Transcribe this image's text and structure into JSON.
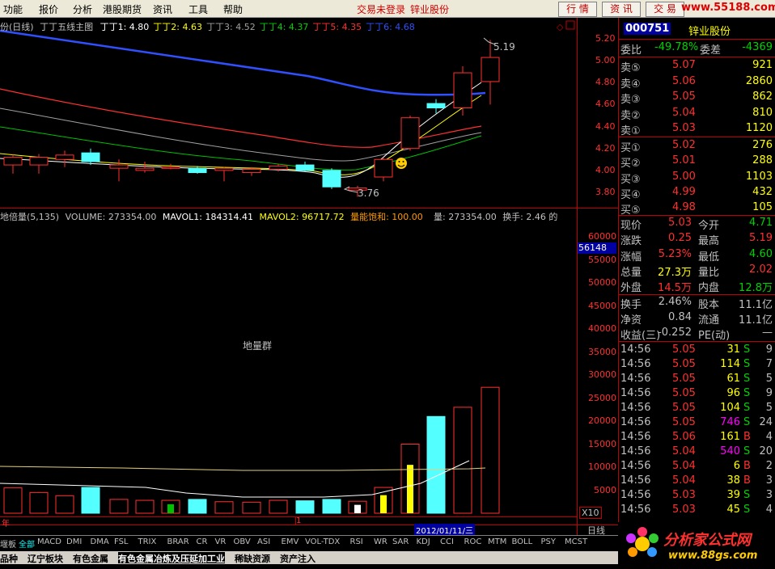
{
  "menu": {
    "items": [
      "功能",
      "报价",
      "分析",
      "港股期货",
      "资讯",
      "工具",
      "帮助"
    ],
    "login_status": "交易未登录",
    "stock_name": "锌业股份",
    "buttons": [
      "行 情",
      "资 讯",
      "交 易"
    ],
    "site": "www.55188.com"
  },
  "main_legend": {
    "period": "份(日线)",
    "indicator": "丁丁五线主图",
    "lines": [
      {
        "label": "丁丁1: 4.80",
        "color": "#ffffff"
      },
      {
        "label": "丁丁2: 4.63",
        "color": "#ffff00"
      },
      {
        "label": "丁丁3: 4.52",
        "color": "#a0a0a0"
      },
      {
        "label": "丁丁4: 4.37",
        "color": "#00d000"
      },
      {
        "label": "丁丁5: 4.35",
        "color": "#ff3030"
      },
      {
        "label": "丁丁6: 4.68",
        "color": "#3050ff"
      }
    ],
    "high_mark": "5.19",
    "low_mark": "3.76"
  },
  "price_axis": [
    "5.20",
    "5.00",
    "4.80",
    "4.60",
    "4.40",
    "4.20",
    "4.00",
    "3.80"
  ],
  "volume_legend": {
    "name": "地倍量(5,135)",
    "volume": "VOLUME: 273354.00",
    "mavol1": "MAVOL1: 184314.41",
    "mavol2": "MAVOL2: 96717.72",
    "saturation": "量能饱和: 100.00",
    "liang": "量: 273354.00",
    "turnover": "换手: 2.46 的"
  },
  "volume_axis": [
    "60000",
    "55000",
    "50000",
    "45000",
    "40000",
    "35000",
    "30000",
    "25000",
    "20000",
    "15000",
    "10000",
    "5000"
  ],
  "volume_axis_highlight": "56148",
  "volume_axis_unit": "X10",
  "volume_center_label": "地量群",
  "date_label": "2012/01/11/三",
  "bottom_left": {
    "year_label": "年",
    "month_label": "1"
  },
  "period_tab": "日线",
  "chart_data": {
    "type": "candlestick",
    "price_range": [
      3.7,
      5.25
    ],
    "candles": [
      {
        "o": 4.05,
        "c": 4.12,
        "h": 4.15,
        "l": 3.97,
        "up": false
      },
      {
        "o": 4.05,
        "c": 4.12,
        "h": 4.15,
        "l": 3.97,
        "up": false
      },
      {
        "o": 4.1,
        "c": 4.14,
        "h": 4.18,
        "l": 4.03,
        "up": false
      },
      {
        "o": 4.08,
        "c": 4.16,
        "h": 4.2,
        "l": 4.05,
        "up": true
      },
      {
        "o": 4.05,
        "c": 4.02,
        "h": 4.1,
        "l": 3.9,
        "up": false
      },
      {
        "o": 4.02,
        "c": 4.0,
        "h": 4.08,
        "l": 3.98,
        "up": false
      },
      {
        "o": 4.03,
        "c": 4.03,
        "h": 4.06,
        "l": 4.01,
        "up": false
      },
      {
        "o": 3.98,
        "c": 4.02,
        "h": 4.04,
        "l": 3.97,
        "up": true
      },
      {
        "o": 4.02,
        "c": 4.0,
        "h": 4.03,
        "l": 3.9,
        "up": false
      },
      {
        "o": 4.01,
        "c": 3.98,
        "h": 4.03,
        "l": 3.95,
        "up": false
      },
      {
        "o": 4.01,
        "c": 4.04,
        "h": 4.06,
        "l": 3.99,
        "up": false
      },
      {
        "o": 4.05,
        "c": 4.0,
        "h": 4.08,
        "l": 3.99,
        "up": true
      },
      {
        "o": 4.0,
        "c": 3.85,
        "h": 4.02,
        "l": 3.83,
        "up": true
      },
      {
        "o": 3.82,
        "c": 3.84,
        "h": 3.86,
        "l": 3.76,
        "up": false
      },
      {
        "o": 3.94,
        "c": 4.1,
        "h": 4.12,
        "l": 3.9,
        "up": false
      },
      {
        "o": 4.2,
        "c": 4.48,
        "h": 4.5,
        "l": 4.18,
        "up": false
      },
      {
        "o": 4.57,
        "c": 4.61,
        "h": 4.65,
        "l": 4.52,
        "up": true
      },
      {
        "o": 4.57,
        "c": 4.89,
        "h": 4.95,
        "l": 4.5,
        "up": false
      },
      {
        "o": 4.81,
        "c": 5.03,
        "h": 5.19,
        "l": 4.6,
        "up": false
      }
    ],
    "volume_range": [
      0,
      65000
    ],
    "volumes": [
      5500,
      4500,
      3800,
      5600,
      3000,
      2800,
      2800,
      3000,
      2500,
      2400,
      2800,
      2700,
      3000,
      2600,
      5600,
      15000,
      21000,
      23000,
      27335
    ]
  },
  "right_panel": {
    "code": "000751",
    "name": "锌业股份",
    "weibi": {
      "label": "委比",
      "value": "-49.78%",
      "label2": "委差",
      "value2": "-4369"
    },
    "asks": [
      {
        "label": "卖⑤",
        "price": "5.07",
        "vol": "921"
      },
      {
        "label": "卖④",
        "price": "5.06",
        "vol": "2860"
      },
      {
        "label": "卖③",
        "price": "5.05",
        "vol": "862"
      },
      {
        "label": "卖②",
        "price": "5.04",
        "vol": "810"
      },
      {
        "label": "卖①",
        "price": "5.03",
        "vol": "1120"
      }
    ],
    "bids": [
      {
        "label": "买①",
        "price": "5.02",
        "vol": "276"
      },
      {
        "label": "买②",
        "price": "5.01",
        "vol": "288"
      },
      {
        "label": "买③",
        "price": "5.00",
        "vol": "1103"
      },
      {
        "label": "买④",
        "price": "4.99",
        "vol": "432"
      },
      {
        "label": "买⑤",
        "price": "4.98",
        "vol": "105"
      }
    ],
    "stats": [
      {
        "l1": "现价",
        "v1": "5.03",
        "c1": "#ff3030",
        "l2": "今开",
        "v2": "4.71",
        "c2": "#00d000"
      },
      {
        "l1": "涨跌",
        "v1": "0.25",
        "c1": "#ff3030",
        "l2": "最高",
        "v2": "5.19",
        "c2": "#ff3030"
      },
      {
        "l1": "涨幅",
        "v1": "5.23%",
        "c1": "#ff3030",
        "l2": "最低",
        "v2": "4.60",
        "c2": "#00d000"
      },
      {
        "l1": "总量",
        "v1": "27.3万",
        "c1": "#ffff00",
        "l2": "量比",
        "v2": "2.02",
        "c2": "#ff3030"
      },
      {
        "l1": "外盘",
        "v1": "14.5万",
        "c1": "#ff3030",
        "l2": "内盘",
        "v2": "12.8万",
        "c2": "#00d000"
      }
    ],
    "fin": [
      {
        "l1": "换手",
        "v1": "2.46%",
        "l2": "股本",
        "v2": "11.1亿"
      },
      {
        "l1": "净资",
        "v1": "0.84",
        "l2": "流通",
        "v2": "11.1亿"
      },
      {
        "l1": "收益(三)",
        "v1": "-0.252",
        "l2": "PE(动)",
        "v2": "—"
      }
    ],
    "ticks": [
      {
        "t": "14:56",
        "p": "5.05",
        "v": "31",
        "d": "S",
        "n": "9",
        "vc": "#ffff00"
      },
      {
        "t": "14:56",
        "p": "5.05",
        "v": "114",
        "d": "S",
        "n": "7",
        "vc": "#ffff00"
      },
      {
        "t": "14:56",
        "p": "5.05",
        "v": "61",
        "d": "S",
        "n": "5",
        "vc": "#ffff00"
      },
      {
        "t": "14:56",
        "p": "5.05",
        "v": "96",
        "d": "S",
        "n": "9",
        "vc": "#ffff00"
      },
      {
        "t": "14:56",
        "p": "5.05",
        "v": "104",
        "d": "S",
        "n": "5",
        "vc": "#ffff00"
      },
      {
        "t": "14:56",
        "p": "5.05",
        "v": "746",
        "d": "S",
        "n": "24",
        "vc": "#ff00ff"
      },
      {
        "t": "14:56",
        "p": "5.06",
        "v": "161",
        "d": "B",
        "n": "4",
        "vc": "#ffff00"
      },
      {
        "t": "14:56",
        "p": "5.04",
        "v": "540",
        "d": "S",
        "n": "20",
        "vc": "#ff00ff"
      },
      {
        "t": "14:56",
        "p": "5.04",
        "v": "6",
        "d": "B",
        "n": "2",
        "vc": "#ffff00"
      },
      {
        "t": "14:56",
        "p": "5.04",
        "v": "38",
        "d": "B",
        "n": "3",
        "vc": "#ffff00"
      },
      {
        "t": "14:56",
        "p": "5.03",
        "v": "39",
        "d": "S",
        "n": "3",
        "vc": "#ffff00"
      },
      {
        "t": "14:56",
        "p": "5.03",
        "v": "45",
        "d": "S",
        "n": "4",
        "vc": "#ffff00"
      }
    ]
  },
  "indicator_tabs": [
    "堰板",
    "全部",
    "MACD",
    "DMI",
    "DMA",
    "FSL",
    "TRIX",
    "BRAR",
    "CR",
    "VR",
    "OBV",
    "ASI",
    "EMV",
    "VOL-TDX",
    "RSI",
    "WR",
    "SAR",
    "KDJ",
    "CCI",
    "ROC",
    "MTM",
    "BOLL",
    "PSY",
    "MCST"
  ],
  "sector_tabs": [
    "品种",
    "辽宁板块",
    "有色金属",
    "有色金属冶炼及压延加工业",
    "稀缺资源",
    "资产注入"
  ],
  "logo": {
    "text": "分析家公式网",
    "url": "www.88gs.com"
  }
}
